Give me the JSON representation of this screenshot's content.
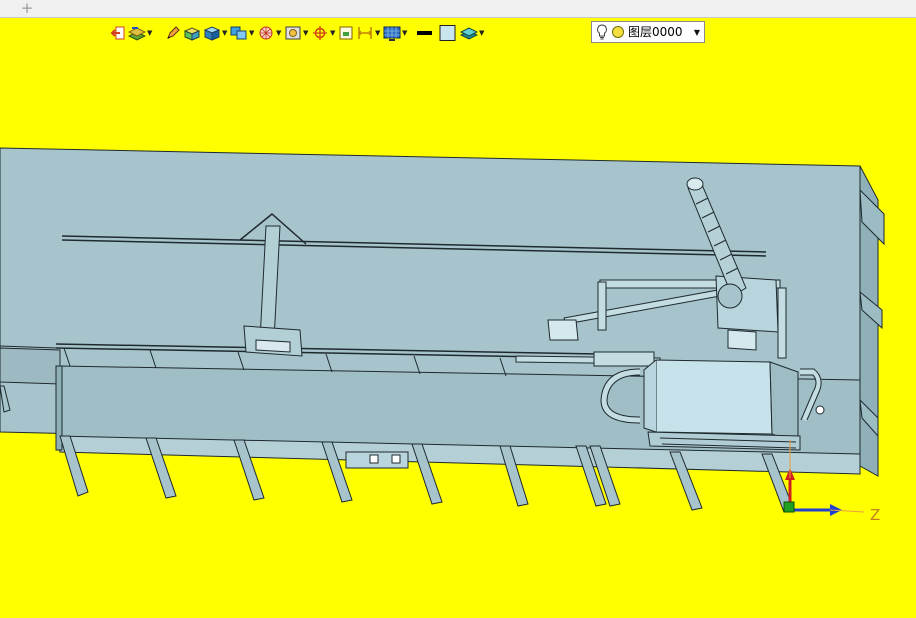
{
  "tabs": {
    "add_label": "+"
  },
  "toolbar": {
    "tools": [
      {
        "icon": "exit-group-icon",
        "dropdown": false
      },
      {
        "icon": "layer-stack-icon",
        "dropdown": true
      },
      {
        "icon": "pencil-icon",
        "dropdown": false
      },
      {
        "icon": "solid-box-icon",
        "dropdown": false
      },
      {
        "icon": "shaded-cube-icon",
        "dropdown": true
      },
      {
        "icon": "view-cubes-icon",
        "dropdown": true
      },
      {
        "icon": "wireframe-sphere-icon",
        "dropdown": true
      },
      {
        "icon": "render-frame-icon",
        "dropdown": true
      },
      {
        "icon": "target-icon",
        "dropdown": true
      },
      {
        "icon": "frame-icon",
        "dropdown": false
      },
      {
        "icon": "dimension-icon",
        "dropdown": true
      },
      {
        "icon": "display-grid-icon",
        "dropdown": true
      },
      {
        "icon": "line-color-icon",
        "dropdown": false
      },
      {
        "icon": "fill-color-icon",
        "dropdown": false
      },
      {
        "icon": "layer-icon",
        "dropdown": true
      }
    ],
    "line_color": "#000000",
    "fill_color": "#c9e6ee"
  },
  "layer": {
    "name": "图层0000",
    "state_icons": [
      "bulb-icon",
      "sun-icon"
    ]
  },
  "viewport": {
    "background": "#ffff00",
    "model_color": "#a7c4cc",
    "edge_color": "#1e2a2e"
  },
  "axes": {
    "z_label": "Z",
    "x_color": "#d02020",
    "y_color": "#20a020",
    "z_color": "#2040d0"
  }
}
